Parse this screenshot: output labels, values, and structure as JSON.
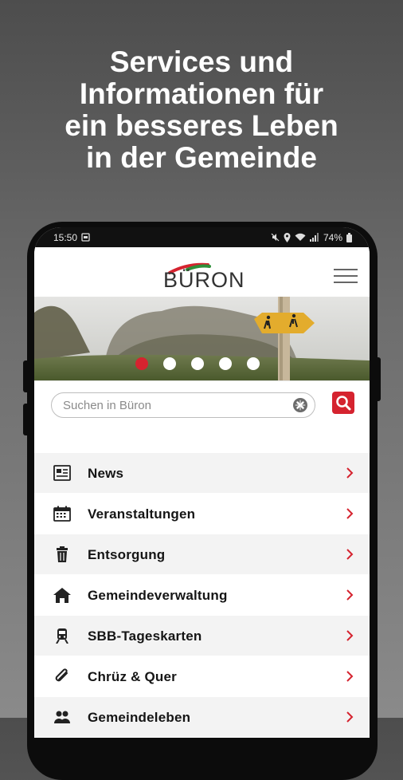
{
  "promo": {
    "title": "Services und\nInformationen für\nein besseres Leben\nin der Gemeinde"
  },
  "status_bar": {
    "time": "15:50",
    "battery": "74%"
  },
  "app_header": {
    "logo_text": "BÜRON",
    "menu_icon": "hamburger-icon"
  },
  "hero": {
    "slide_count": 5,
    "active_slide": 1
  },
  "search": {
    "placeholder": "Suchen in Büron",
    "value": "",
    "clear_icon": "clear-icon",
    "button_icon": "search-icon"
  },
  "menu": {
    "items": [
      {
        "label": "News",
        "icon": "newspaper-icon"
      },
      {
        "label": "Veranstaltungen",
        "icon": "calendar-icon"
      },
      {
        "label": "Entsorgung",
        "icon": "trash-icon"
      },
      {
        "label": "Gemeindeverwaltung",
        "icon": "home-icon"
      },
      {
        "label": "SBB-Tageskarten",
        "icon": "train-icon"
      },
      {
        "label": "Chrüz & Quer",
        "icon": "paperclip-icon"
      },
      {
        "label": "Gemeindeleben",
        "icon": "people-icon"
      }
    ]
  },
  "colors": {
    "accent": "#d5232f",
    "logo_green": "#2f8f3a"
  }
}
